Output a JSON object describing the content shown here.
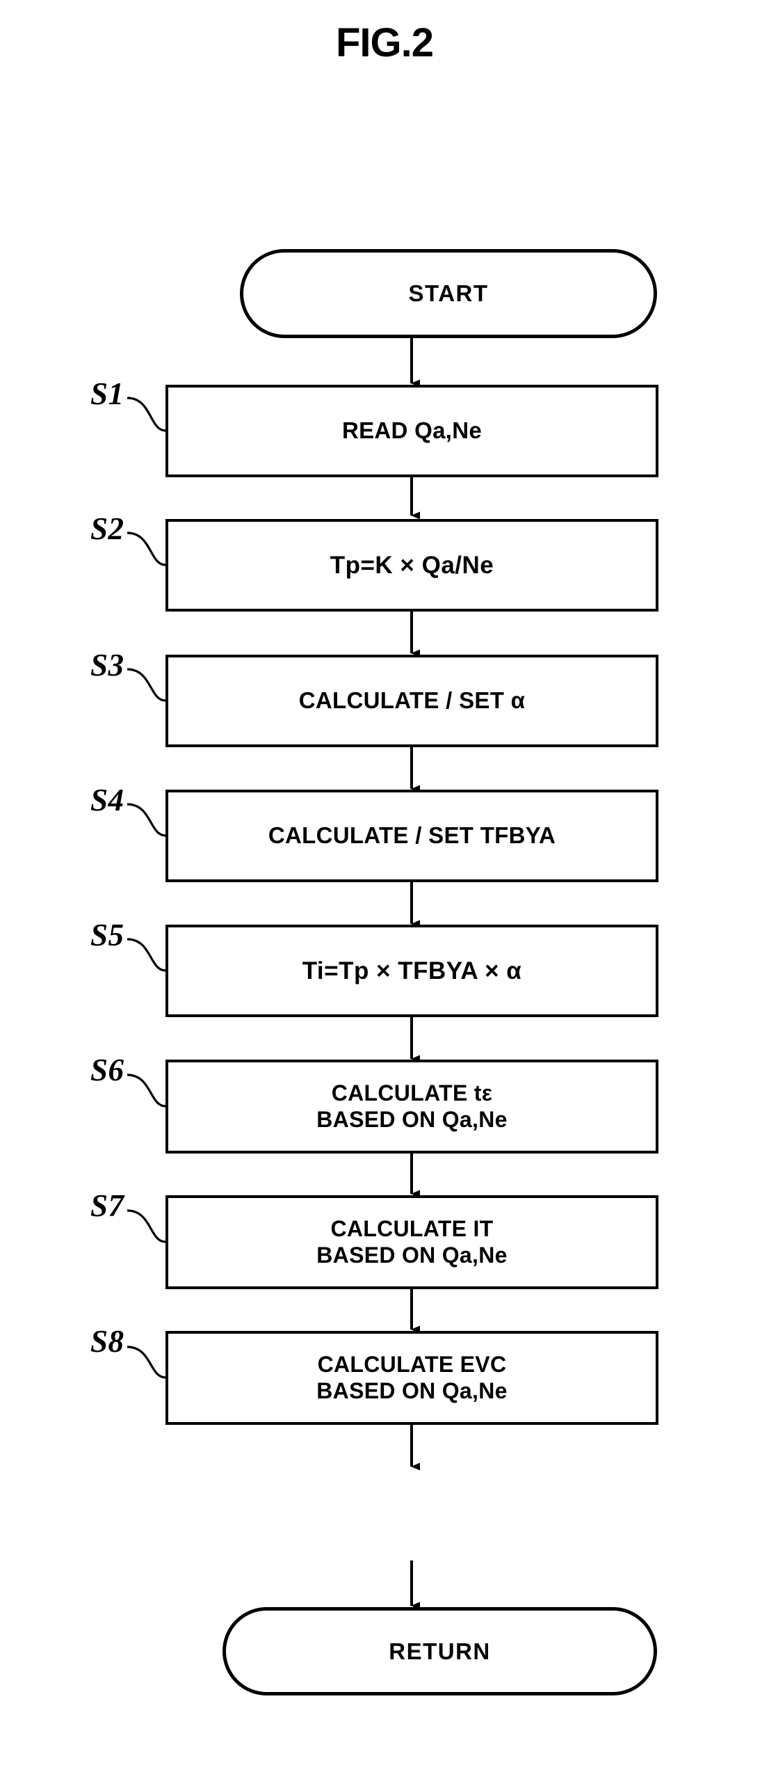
{
  "figure": {
    "title": "FIG.2",
    "type": "flowchart"
  },
  "flowchart": {
    "start": {
      "label": "START",
      "shape": "terminator"
    },
    "end": {
      "label": "RETURN",
      "shape": "terminator"
    },
    "steps": [
      {
        "ref": "S1",
        "text": "READ Qa,Ne",
        "shape": "process",
        "lines": 1
      },
      {
        "ref": "S2",
        "text": "Tp=K × Qa/Ne",
        "shape": "process",
        "lines": 1
      },
      {
        "ref": "S3",
        "text": "CALCULATE / SET α",
        "shape": "process",
        "lines": 1
      },
      {
        "ref": "S4",
        "text": "CALCULATE / SET TFBYA",
        "shape": "process",
        "lines": 1
      },
      {
        "ref": "S5",
        "text": "Ti=Tp × TFBYA × α",
        "shape": "process",
        "lines": 1
      },
      {
        "ref": "S6",
        "text": "CALCULATE tε\nBASED ON Qa,Ne",
        "shape": "process",
        "lines": 2
      },
      {
        "ref": "S7",
        "text": "CALCULATE IT\nBASED ON Qa,Ne",
        "shape": "process",
        "lines": 2
      },
      {
        "ref": "S8",
        "text": "CALCULATE EVC\nBASED ON Qa,Ne",
        "shape": "process",
        "lines": 2
      }
    ]
  },
  "style": {
    "ink": "#000000",
    "paper": "#ffffff"
  }
}
